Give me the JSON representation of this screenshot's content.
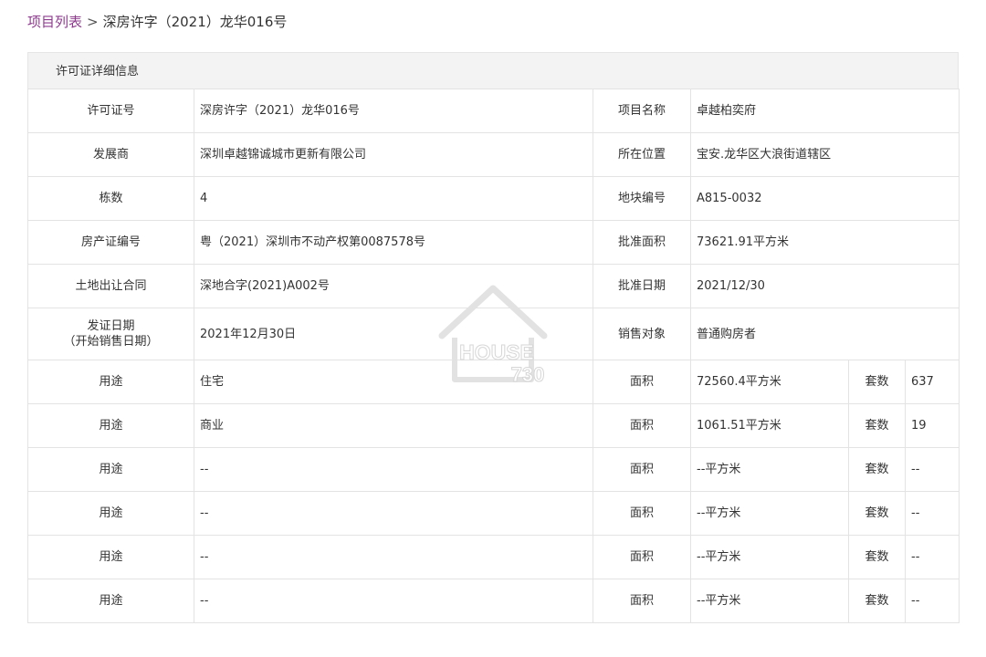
{
  "breadcrumb": {
    "link": "项目列表",
    "separator": ">",
    "current": "深房许字（2021）龙华016号"
  },
  "panel": {
    "title": "许可证详细信息"
  },
  "info": {
    "permit_no_label": "许可证号",
    "permit_no": "深房许字（2021）龙华016号",
    "project_name_label": "项目名称",
    "project_name": "卓越柏奕府",
    "developer_label": "发展商",
    "developer": "深圳卓越锦诚城市更新有限公司",
    "location_label": "所在位置",
    "location": "宝安.龙华区大浪街道辖区",
    "buildings_label": "栋数",
    "buildings": "4",
    "plot_no_label": "地块编号",
    "plot_no": "A815-0032",
    "property_cert_label": "房产证编号",
    "property_cert": "粤（2021）深圳市不动产权第0087578号",
    "approved_area_label": "批准面积",
    "approved_area": "73621.91平方米",
    "land_contract_label": "土地出让合同",
    "land_contract": "深地合字(2021)A002号",
    "approved_date_label": "批准日期",
    "approved_date": "2021/12/30",
    "issue_date_label_1": "发证日期",
    "issue_date_label_2": "（开始销售日期）",
    "issue_date": "2021年12月30日",
    "sales_target_label": "销售对象",
    "sales_target": "普通购房者"
  },
  "usage_labels": {
    "usage": "用途",
    "area": "面积",
    "units": "套数"
  },
  "usage_rows": [
    {
      "usage": "住宅",
      "area": "72560.4平方米",
      "units": "637"
    },
    {
      "usage": "商业",
      "area": "1061.51平方米",
      "units": "19"
    },
    {
      "usage": "--",
      "area": "--平方米",
      "units": "--"
    },
    {
      "usage": "--",
      "area": "--平方米",
      "units": "--"
    },
    {
      "usage": "--",
      "area": "--平方米",
      "units": "--"
    },
    {
      "usage": "--",
      "area": "--平方米",
      "units": "--"
    }
  ],
  "watermark": {
    "line1": "HOUSE",
    "line2": "730"
  }
}
